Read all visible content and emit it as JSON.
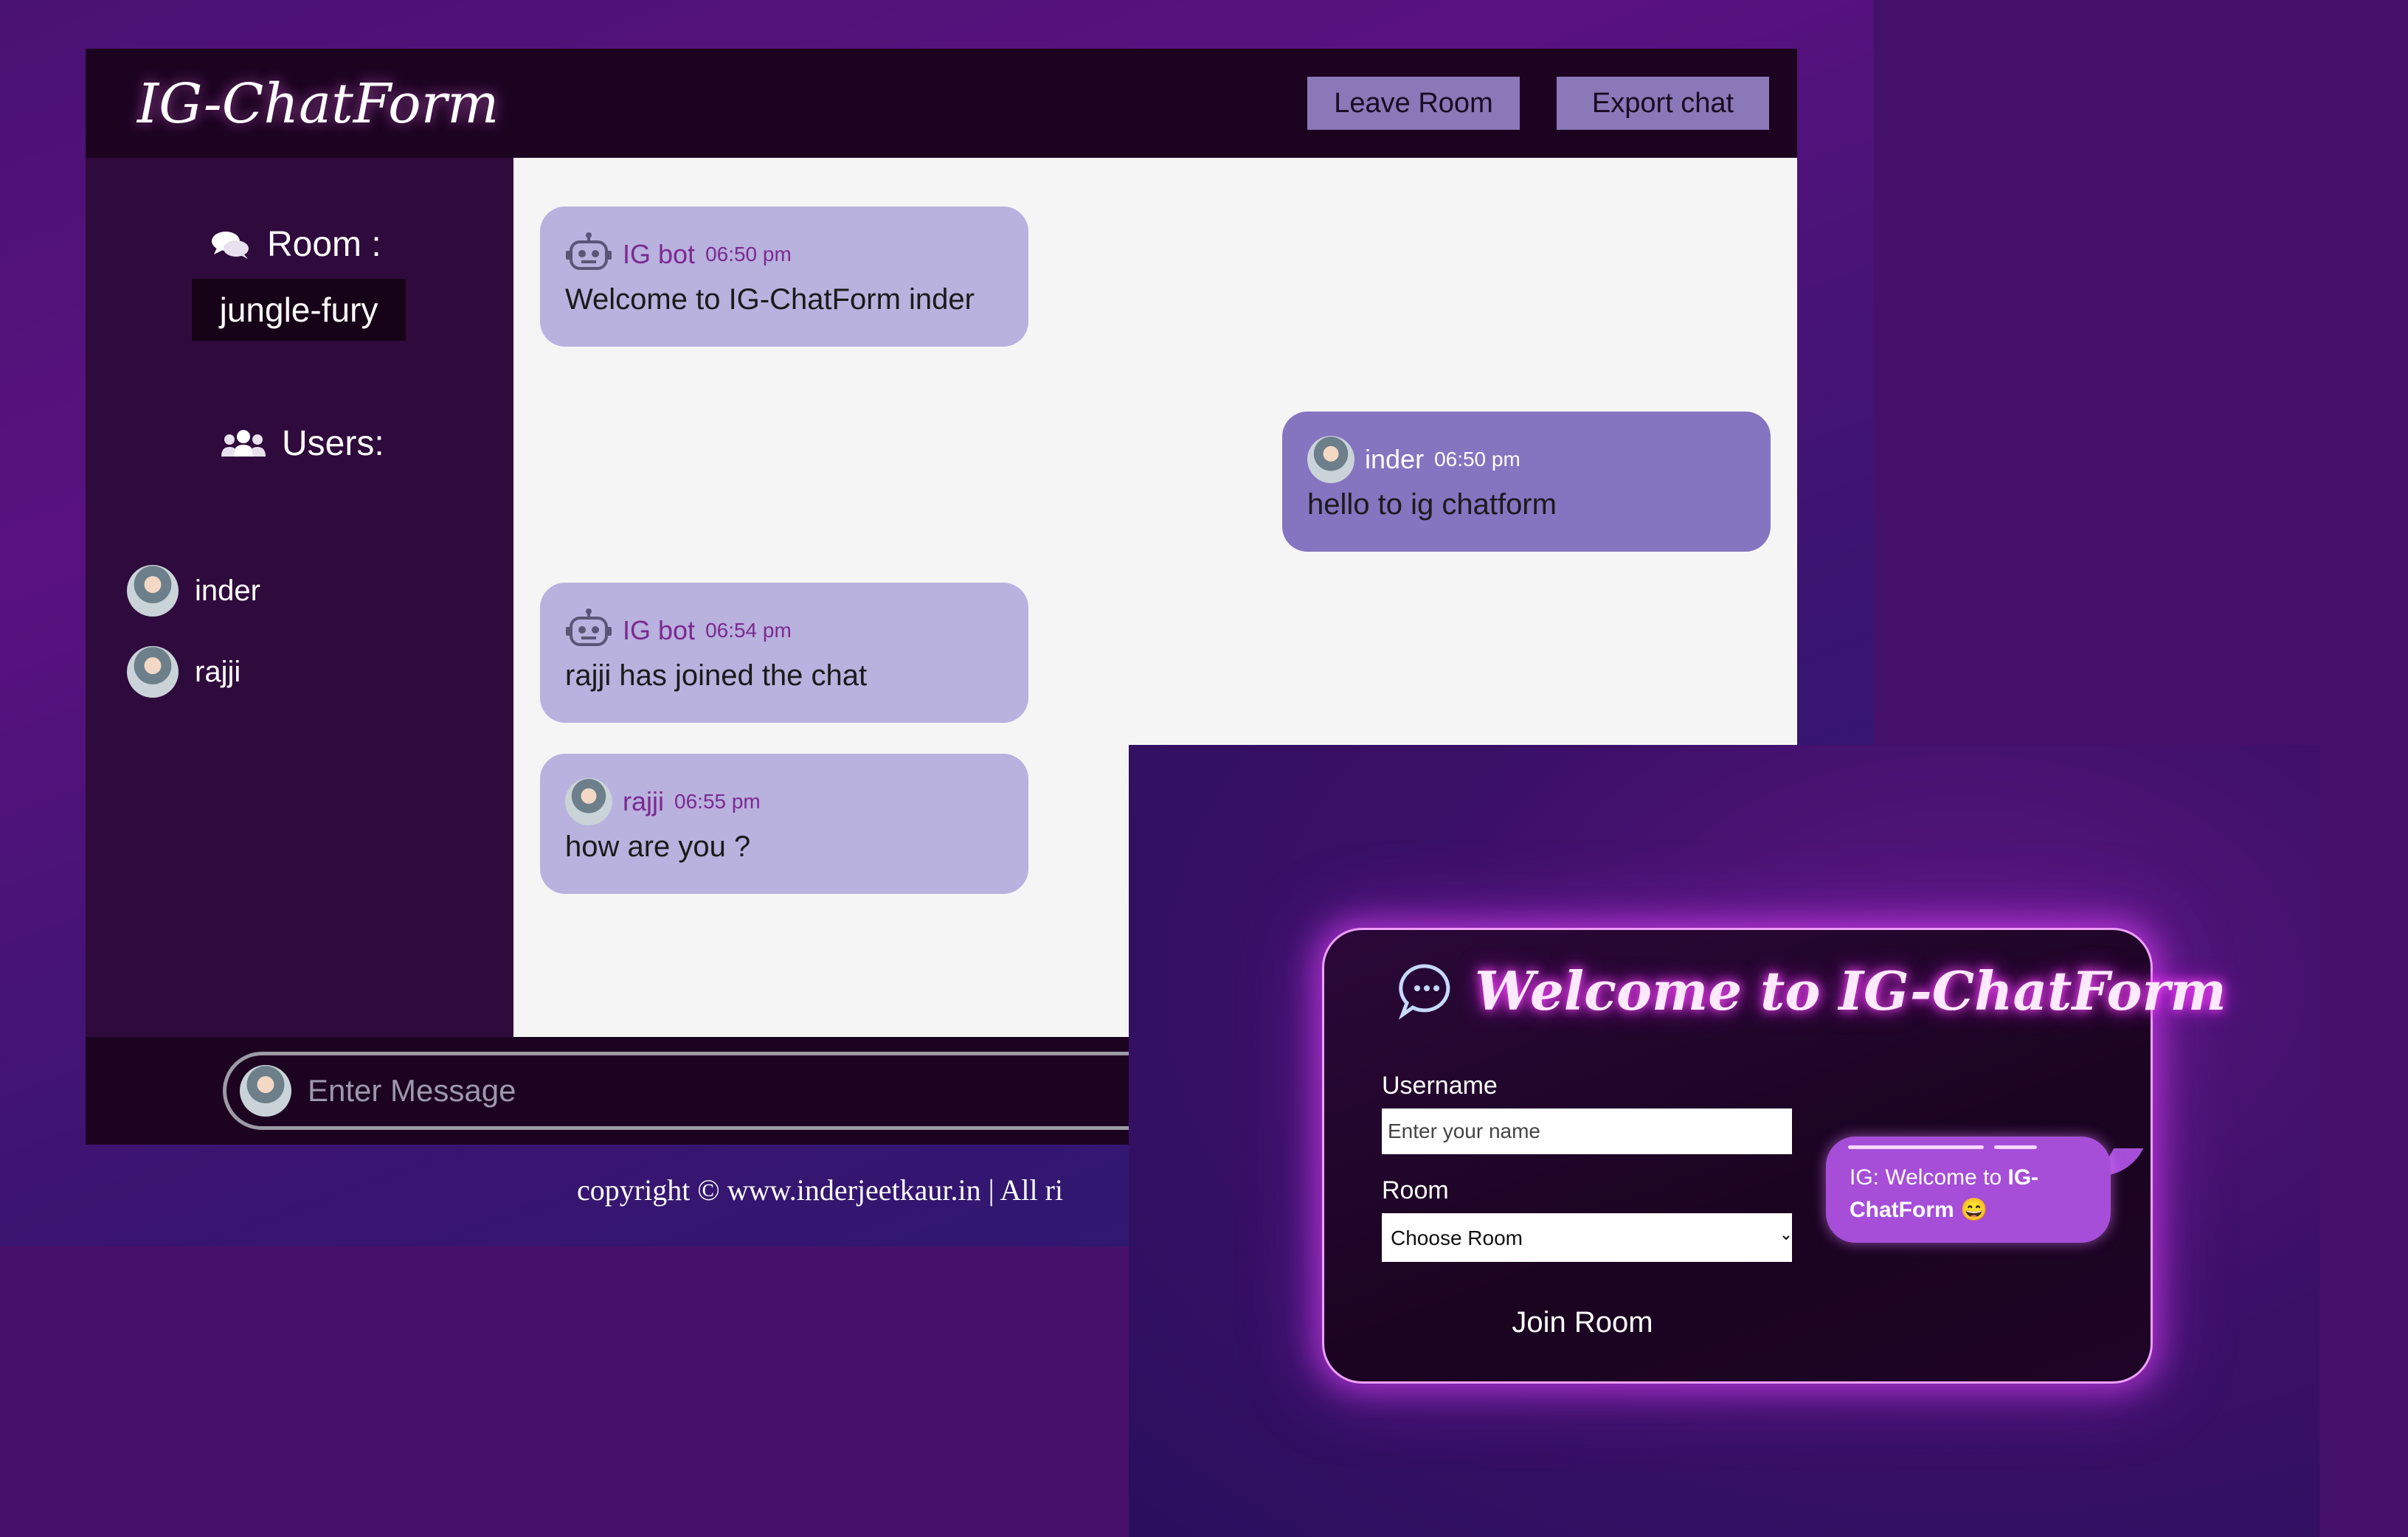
{
  "chat": {
    "brand": "IG-ChatForm",
    "leave_button": "Leave Room",
    "export_button": "Export chat",
    "room_label": "Room :",
    "room_name": "jungle-fury",
    "users_label": "Users:",
    "users": [
      "inder",
      "rajji"
    ],
    "messages": [
      {
        "user": "IG bot",
        "time": "06:50 pm",
        "text": "Welcome to IG-ChatForm inder"
      },
      {
        "user": "inder",
        "time": "06:50 pm",
        "text": "hello to ig chatform"
      },
      {
        "user": "IG bot",
        "time": "06:54 pm",
        "text": "rajji has joined the chat"
      },
      {
        "user": "rajji",
        "time": "06:55 pm",
        "text": "how are you ?"
      }
    ],
    "message_placeholder": "Enter Message",
    "copyright": "copyright © www.inderjeetkaur.in | All ri"
  },
  "login": {
    "title": "Welcome to IG-ChatForm",
    "username_label": "Username",
    "username_placeholder": "Enter your name",
    "room_label": "Room",
    "room_selected": "Choose Room",
    "join_button": "Join Room",
    "bubble_prefix": "IG: Welcome to ",
    "bubble_bold": "IG-ChatForm",
    "bubble_emoji": "😄"
  },
  "colors": {
    "header_bg": "#1c0421",
    "sidebar_bg": "#2f0a3c",
    "bot_bubble": "#b9b1de",
    "self_bubble": "#8574c0",
    "neon": "#ff4dff"
  }
}
